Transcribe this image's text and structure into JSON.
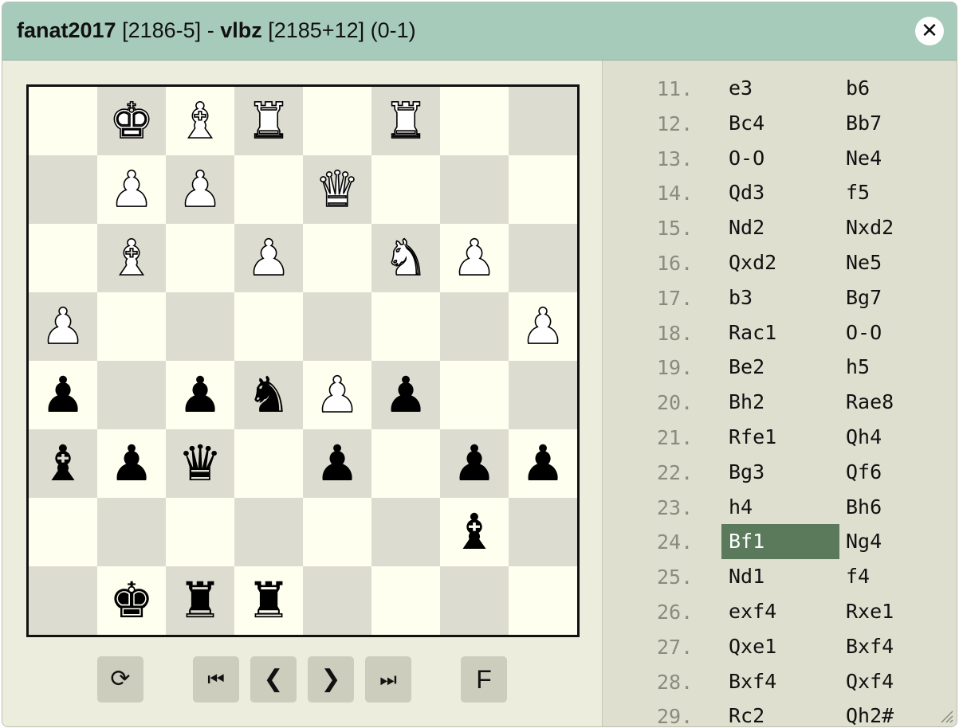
{
  "titlebar": {
    "white_player": "fanat2017",
    "white_rating": "[2186-5]",
    "separator": "-",
    "black_player": "vlbz",
    "black_rating": "[2185+12]",
    "result": "(0-1)",
    "close_glyph": "✕"
  },
  "board": {
    "pieces": [
      {
        "sq": "b1",
        "glyph": "♚",
        "color": "white"
      },
      {
        "sq": "c1",
        "glyph": "♝",
        "color": "white"
      },
      {
        "sq": "d1",
        "glyph": "♜",
        "color": "white"
      },
      {
        "sq": "f1",
        "glyph": "♜",
        "color": "white"
      },
      {
        "sq": "b2",
        "glyph": "♟",
        "color": "white"
      },
      {
        "sq": "c2",
        "glyph": "♟",
        "color": "white"
      },
      {
        "sq": "e2",
        "glyph": "♛",
        "color": "white"
      },
      {
        "sq": "b3",
        "glyph": "♝",
        "color": "white"
      },
      {
        "sq": "d3",
        "glyph": "♟",
        "color": "white"
      },
      {
        "sq": "f3",
        "glyph": "♞",
        "color": "white"
      },
      {
        "sq": "g3",
        "glyph": "♟",
        "color": "white"
      },
      {
        "sq": "a4",
        "glyph": "♟",
        "color": "white"
      },
      {
        "sq": "h4",
        "glyph": "♟",
        "color": "white"
      },
      {
        "sq": "a5",
        "glyph": "♟",
        "color": "black"
      },
      {
        "sq": "c5",
        "glyph": "♟",
        "color": "black"
      },
      {
        "sq": "d5",
        "glyph": "♞",
        "color": "black"
      },
      {
        "sq": "e5",
        "glyph": "♟",
        "color": "white"
      },
      {
        "sq": "f5",
        "glyph": "♟",
        "color": "black"
      },
      {
        "sq": "a6",
        "glyph": "♝",
        "color": "black"
      },
      {
        "sq": "b6",
        "glyph": "♟",
        "color": "black"
      },
      {
        "sq": "c6",
        "glyph": "♛",
        "color": "black"
      },
      {
        "sq": "e6",
        "glyph": "♟",
        "color": "black"
      },
      {
        "sq": "g6",
        "glyph": "♟",
        "color": "black"
      },
      {
        "sq": "h6",
        "glyph": "♟",
        "color": "black"
      },
      {
        "sq": "g7",
        "glyph": "♝",
        "color": "black"
      },
      {
        "sq": "b8",
        "glyph": "♚",
        "color": "black"
      },
      {
        "sq": "c8",
        "glyph": "♜",
        "color": "black"
      },
      {
        "sq": "d8",
        "glyph": "♜",
        "color": "black"
      }
    ]
  },
  "controls": {
    "flip_glyph": "⟳",
    "first_glyph": "⏮",
    "prev_glyph": "❮",
    "next_glyph": "❯",
    "last_glyph": "⏭",
    "f_label": "F"
  },
  "moves": [
    {
      "num": "11.",
      "white": "e3",
      "black": "b6"
    },
    {
      "num": "12.",
      "white": "Bc4",
      "black": "Bb7"
    },
    {
      "num": "13.",
      "white": "O-O",
      "black": "Ne4"
    },
    {
      "num": "14.",
      "white": "Qd3",
      "black": "f5"
    },
    {
      "num": "15.",
      "white": "Nd2",
      "black": "Nxd2"
    },
    {
      "num": "16.",
      "white": "Qxd2",
      "black": "Ne5"
    },
    {
      "num": "17.",
      "white": "b3",
      "black": "Bg7"
    },
    {
      "num": "18.",
      "white": "Rac1",
      "black": "O-O"
    },
    {
      "num": "19.",
      "white": "Be2",
      "black": "h5"
    },
    {
      "num": "20.",
      "white": "Bh2",
      "black": "Rae8"
    },
    {
      "num": "21.",
      "white": "Rfe1",
      "black": "Qh4"
    },
    {
      "num": "22.",
      "white": "Bg3",
      "black": "Qf6"
    },
    {
      "num": "23.",
      "white": "h4",
      "black": "Bh6"
    },
    {
      "num": "24.",
      "white": "Bf1",
      "black": "Ng4",
      "selected": "white"
    },
    {
      "num": "25.",
      "white": "Nd1",
      "black": "f4"
    },
    {
      "num": "26.",
      "white": "exf4",
      "black": "Rxe1"
    },
    {
      "num": "27.",
      "white": "Qxe1",
      "black": "Bxf4"
    },
    {
      "num": "28.",
      "white": "Bxf4",
      "black": "Qxf4"
    },
    {
      "num": "29.",
      "white": "Rc2",
      "black": "Qh2#"
    }
  ],
  "colors": {
    "titlebar": "#a6cbbb",
    "selected_move": "#5a7a5b",
    "light_square": "#fffff0",
    "dark_square": "#dddcd0"
  }
}
